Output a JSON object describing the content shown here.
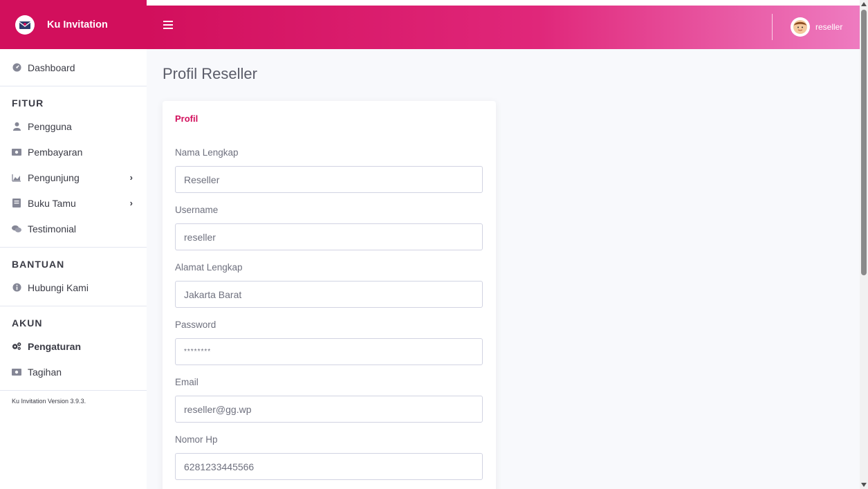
{
  "app": {
    "brand": "Ku Invitation"
  },
  "user": {
    "name": "reseller"
  },
  "sidebar": {
    "dashboard": "Dashboard",
    "sections": [
      {
        "heading": "FITUR"
      },
      {
        "heading": "BANTUAN"
      },
      {
        "heading": "AKUN"
      }
    ],
    "items": {
      "pengguna": "Pengguna",
      "pembayaran": "Pembayaran",
      "pengunjung": "Pengunjung",
      "buku_tamu": "Buku Tamu",
      "testimonial": "Testimonial",
      "hubungi_kami": "Hubungi Kami",
      "pengaturan": "Pengaturan",
      "tagihan": "Tagihan"
    },
    "version": "Ku Invitation Version 3.9.3."
  },
  "page": {
    "title": "Profil Reseller"
  },
  "card": {
    "header": "Profil",
    "fields": [
      {
        "label": "Nama Lengkap",
        "value": "Reseller"
      },
      {
        "label": "Username",
        "value": "reseller"
      },
      {
        "label": "Alamat Lengkap",
        "value": "Jakarta Barat"
      },
      {
        "label": "Password",
        "value": "********"
      },
      {
        "label": "Email",
        "value": "reseller@gg.wp"
      },
      {
        "label": "Nomor Hp",
        "value": "6281233445566"
      }
    ]
  },
  "colors": {
    "brand": "#d20f5c",
    "accent_light": "#ee7bc0"
  }
}
